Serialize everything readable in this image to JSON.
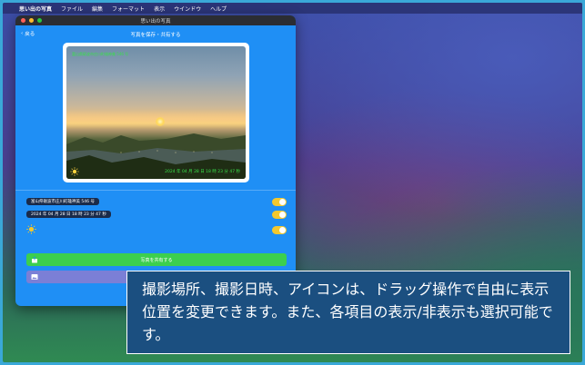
{
  "menubar": {
    "app_name": "思い出の写真",
    "items": [
      "ファイル",
      "編集",
      "フォーマット",
      "表示",
      "ウインドウ",
      "ヘルプ"
    ]
  },
  "window": {
    "title": "思い出の写真",
    "nav_title": "写真を保存・共有する",
    "back_label": "戻る"
  },
  "photo": {
    "place_overlay": "富山県砺波市庄川町雄神美 546 号",
    "date_overlay": "2024 年 04 月 28 日 18 時 23 分 47 秒",
    "weather_icon": "sun-icon"
  },
  "options": [
    {
      "label": "富山県砺波市庄川町雄神美 546 号",
      "enabled": true
    },
    {
      "label": "2024 年 04 月 28 日 18 時 23 分 47 秒",
      "enabled": true
    },
    {
      "label": "",
      "icon": "sun-icon",
      "enabled": true
    }
  ],
  "buttons": {
    "share_label": "写真を共有する",
    "save_label": ""
  },
  "caption": "撮影場所、撮影日時、アイコンは、ドラッグ操作で自由に表示位置を変更できます。また、各項目の表示/非表示も選択可能です。",
  "colors": {
    "window_bg": "#1f8ff5",
    "share_button": "#3ccf4e",
    "save_button": "#7b7fd6",
    "toggle_on": "#f3c82e",
    "overlay_text": "#38e04a",
    "caption_bg": "#1b4f80"
  }
}
